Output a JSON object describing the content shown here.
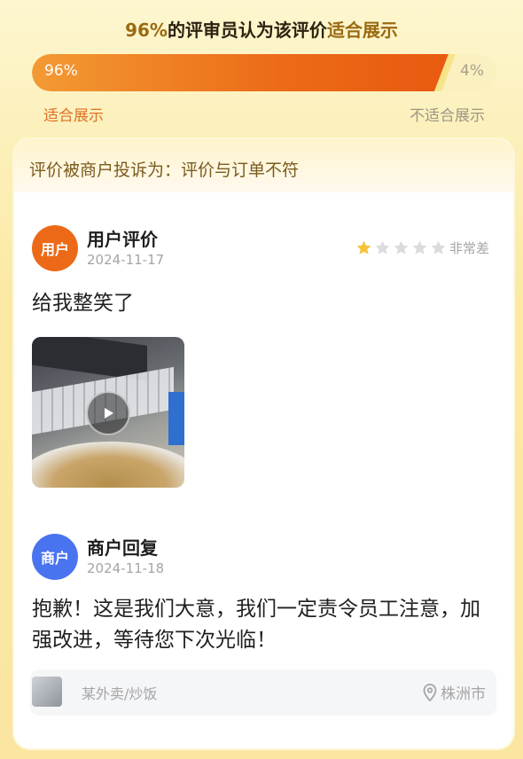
{
  "headline": {
    "percent": "96%",
    "middle": "的评审员认为该评价",
    "highlight": "适合展示"
  },
  "vote_bar": {
    "suitable_fraction": 0.96,
    "suitable_label": "96%",
    "unsuitable_label": "4%",
    "legend_suitable": "适合展示",
    "legend_unsuitable": "不适合展示",
    "colors": {
      "suitable": "#ec6a17",
      "unsuitable": "#fbf0c0"
    }
  },
  "complaint": {
    "title": "评价被商户投诉为：评价与订单不符"
  },
  "user_review": {
    "avatar_label": "用户",
    "avatar_color": "#ec6a17",
    "name": "用户评价",
    "date": "2024-11-17",
    "rating": 1,
    "rating_max": 5,
    "rating_text": "非常差",
    "text": "给我整笑了",
    "media": "video-thumbnail"
  },
  "merchant_reply": {
    "avatar_label": "商户",
    "avatar_color": "#4a73f0",
    "name": "商户回复",
    "date": "2024-11-18",
    "text": "抱歉！这是我们大意，我们一定责令员工注意，加强改进，等待您下次光临！"
  },
  "shop": {
    "name": "某外卖/炒饭",
    "location": "株洲市",
    "location_icon": "location-pin-icon"
  }
}
